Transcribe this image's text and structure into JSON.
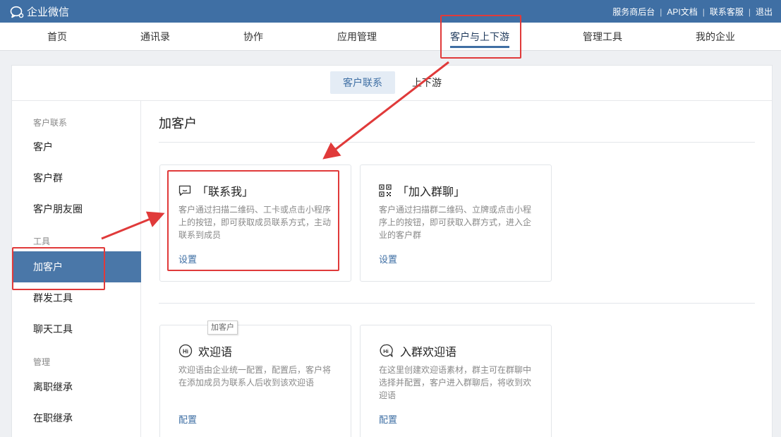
{
  "topbar": {
    "brand": "企业微信",
    "links": [
      "服务商后台",
      "API文档",
      "联系客服",
      "退出"
    ]
  },
  "nav": {
    "items": [
      "首页",
      "通讯录",
      "协作",
      "应用管理",
      "客户与上下游",
      "管理工具",
      "我的企业"
    ],
    "active": "客户与上下游"
  },
  "subtabs": {
    "items": [
      "客户联系",
      "上下游"
    ],
    "active": "客户联系"
  },
  "sidebar": {
    "groups": [
      {
        "title": "客户联系",
        "items": [
          "客户",
          "客户群",
          "客户朋友圈"
        ]
      },
      {
        "title": "工具",
        "items": [
          "加客户",
          "群发工具",
          "聊天工具"
        ]
      },
      {
        "title": "管理",
        "items": [
          "离职继承",
          "在职继承"
        ]
      }
    ],
    "active": "加客户"
  },
  "main": {
    "title": "加客户",
    "cards": [
      {
        "icon": "chat-bubble-icon",
        "title": "「联系我」",
        "desc": "客户通过扫描二维码、工卡或点击小程序上的按钮，即可获取成员联系方式，主动联系到成员",
        "action": "设置"
      },
      {
        "icon": "qr-code-icon",
        "title": "「加入群聊」",
        "desc": "客户通过扫描群二维码、立牌或点击小程序上的按钮，即可获取入群方式，进入企业的客户群",
        "action": "设置"
      },
      {
        "icon": "hi-greeting-icon",
        "title": "欢迎语",
        "desc": "欢迎语由企业统一配置，配置后，客户将在添加成员为联系人后收到该欢迎语",
        "action": "配置"
      },
      {
        "icon": "group-hi-icon",
        "title": "入群欢迎语",
        "desc": "在这里创建欢迎语素材，群主可在群聊中选择并配置，客户进入群聊后，将收到欢迎语",
        "action": "配置"
      }
    ]
  },
  "tooltip": "加客户",
  "colors": {
    "brand": "#3f6fa4",
    "highlight": "#e03a3a",
    "active_side": "#4a77a8"
  }
}
